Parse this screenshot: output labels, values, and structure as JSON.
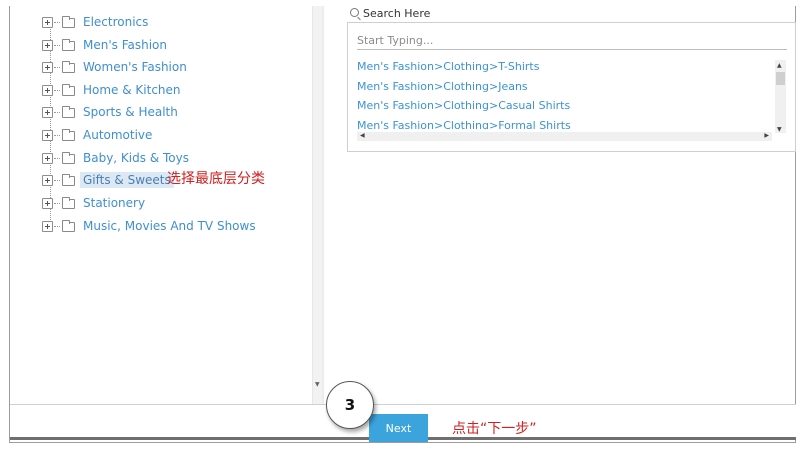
{
  "tree": {
    "items": [
      {
        "label": "Electronics"
      },
      {
        "label": "Men's Fashion"
      },
      {
        "label": "Women's Fashion"
      },
      {
        "label": "Home & Kitchen"
      },
      {
        "label": "Sports & Health"
      },
      {
        "label": "Automotive"
      },
      {
        "label": "Baby, Kids & Toys"
      },
      {
        "label": "Gifts & Sweets",
        "selected": true
      },
      {
        "label": "Stationery"
      },
      {
        "label": "Music, Movies And TV Shows"
      }
    ]
  },
  "annotations": {
    "select_bottom_category": "选择最底层分类",
    "click_next": "点击“下一步”",
    "step_number": "3"
  },
  "search": {
    "title": "Search Here",
    "placeholder": "Start Typing...",
    "results": [
      "Men's Fashion>Clothing>T-Shirts",
      "Men's Fashion>Clothing>Jeans",
      "Men's Fashion>Clothing>Casual Shirts",
      "Men's Fashion>Clothing>Formal Shirts"
    ]
  },
  "footer": {
    "next_label": "Next"
  },
  "colors": {
    "link": "#3f8fcf",
    "button": "#3ba4dc",
    "annotation": "#d02020"
  }
}
